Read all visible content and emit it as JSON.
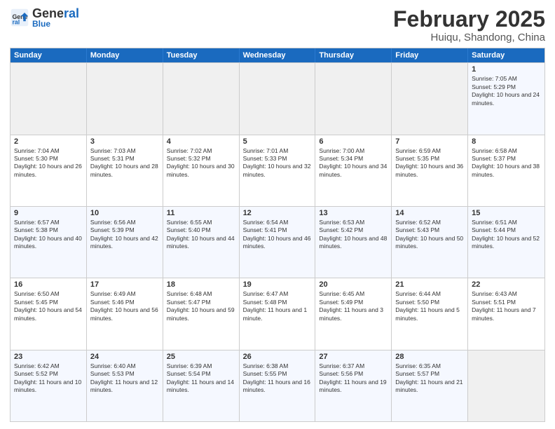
{
  "header": {
    "logo_general": "General",
    "logo_blue": "Blue",
    "title": "February 2025",
    "subtitle": "Huiqu, Shandong, China"
  },
  "days_of_week": [
    "Sunday",
    "Monday",
    "Tuesday",
    "Wednesday",
    "Thursday",
    "Friday",
    "Saturday"
  ],
  "weeks": [
    {
      "cells": [
        {
          "day": "",
          "text": ""
        },
        {
          "day": "",
          "text": ""
        },
        {
          "day": "",
          "text": ""
        },
        {
          "day": "",
          "text": ""
        },
        {
          "day": "",
          "text": ""
        },
        {
          "day": "",
          "text": ""
        },
        {
          "day": "1",
          "text": "Sunrise: 7:05 AM\nSunset: 5:29 PM\nDaylight: 10 hours and 24 minutes."
        }
      ]
    },
    {
      "cells": [
        {
          "day": "2",
          "text": "Sunrise: 7:04 AM\nSunset: 5:30 PM\nDaylight: 10 hours and 26 minutes."
        },
        {
          "day": "3",
          "text": "Sunrise: 7:03 AM\nSunset: 5:31 PM\nDaylight: 10 hours and 28 minutes."
        },
        {
          "day": "4",
          "text": "Sunrise: 7:02 AM\nSunset: 5:32 PM\nDaylight: 10 hours and 30 minutes."
        },
        {
          "day": "5",
          "text": "Sunrise: 7:01 AM\nSunset: 5:33 PM\nDaylight: 10 hours and 32 minutes."
        },
        {
          "day": "6",
          "text": "Sunrise: 7:00 AM\nSunset: 5:34 PM\nDaylight: 10 hours and 34 minutes."
        },
        {
          "day": "7",
          "text": "Sunrise: 6:59 AM\nSunset: 5:35 PM\nDaylight: 10 hours and 36 minutes."
        },
        {
          "day": "8",
          "text": "Sunrise: 6:58 AM\nSunset: 5:37 PM\nDaylight: 10 hours and 38 minutes."
        }
      ]
    },
    {
      "cells": [
        {
          "day": "9",
          "text": "Sunrise: 6:57 AM\nSunset: 5:38 PM\nDaylight: 10 hours and 40 minutes."
        },
        {
          "day": "10",
          "text": "Sunrise: 6:56 AM\nSunset: 5:39 PM\nDaylight: 10 hours and 42 minutes."
        },
        {
          "day": "11",
          "text": "Sunrise: 6:55 AM\nSunset: 5:40 PM\nDaylight: 10 hours and 44 minutes."
        },
        {
          "day": "12",
          "text": "Sunrise: 6:54 AM\nSunset: 5:41 PM\nDaylight: 10 hours and 46 minutes."
        },
        {
          "day": "13",
          "text": "Sunrise: 6:53 AM\nSunset: 5:42 PM\nDaylight: 10 hours and 48 minutes."
        },
        {
          "day": "14",
          "text": "Sunrise: 6:52 AM\nSunset: 5:43 PM\nDaylight: 10 hours and 50 minutes."
        },
        {
          "day": "15",
          "text": "Sunrise: 6:51 AM\nSunset: 5:44 PM\nDaylight: 10 hours and 52 minutes."
        }
      ]
    },
    {
      "cells": [
        {
          "day": "16",
          "text": "Sunrise: 6:50 AM\nSunset: 5:45 PM\nDaylight: 10 hours and 54 minutes."
        },
        {
          "day": "17",
          "text": "Sunrise: 6:49 AM\nSunset: 5:46 PM\nDaylight: 10 hours and 56 minutes."
        },
        {
          "day": "18",
          "text": "Sunrise: 6:48 AM\nSunset: 5:47 PM\nDaylight: 10 hours and 59 minutes."
        },
        {
          "day": "19",
          "text": "Sunrise: 6:47 AM\nSunset: 5:48 PM\nDaylight: 11 hours and 1 minute."
        },
        {
          "day": "20",
          "text": "Sunrise: 6:45 AM\nSunset: 5:49 PM\nDaylight: 11 hours and 3 minutes."
        },
        {
          "day": "21",
          "text": "Sunrise: 6:44 AM\nSunset: 5:50 PM\nDaylight: 11 hours and 5 minutes."
        },
        {
          "day": "22",
          "text": "Sunrise: 6:43 AM\nSunset: 5:51 PM\nDaylight: 11 hours and 7 minutes."
        }
      ]
    },
    {
      "cells": [
        {
          "day": "23",
          "text": "Sunrise: 6:42 AM\nSunset: 5:52 PM\nDaylight: 11 hours and 10 minutes."
        },
        {
          "day": "24",
          "text": "Sunrise: 6:40 AM\nSunset: 5:53 PM\nDaylight: 11 hours and 12 minutes."
        },
        {
          "day": "25",
          "text": "Sunrise: 6:39 AM\nSunset: 5:54 PM\nDaylight: 11 hours and 14 minutes."
        },
        {
          "day": "26",
          "text": "Sunrise: 6:38 AM\nSunset: 5:55 PM\nDaylight: 11 hours and 16 minutes."
        },
        {
          "day": "27",
          "text": "Sunrise: 6:37 AM\nSunset: 5:56 PM\nDaylight: 11 hours and 19 minutes."
        },
        {
          "day": "28",
          "text": "Sunrise: 6:35 AM\nSunset: 5:57 PM\nDaylight: 11 hours and 21 minutes."
        },
        {
          "day": "",
          "text": ""
        }
      ]
    }
  ]
}
